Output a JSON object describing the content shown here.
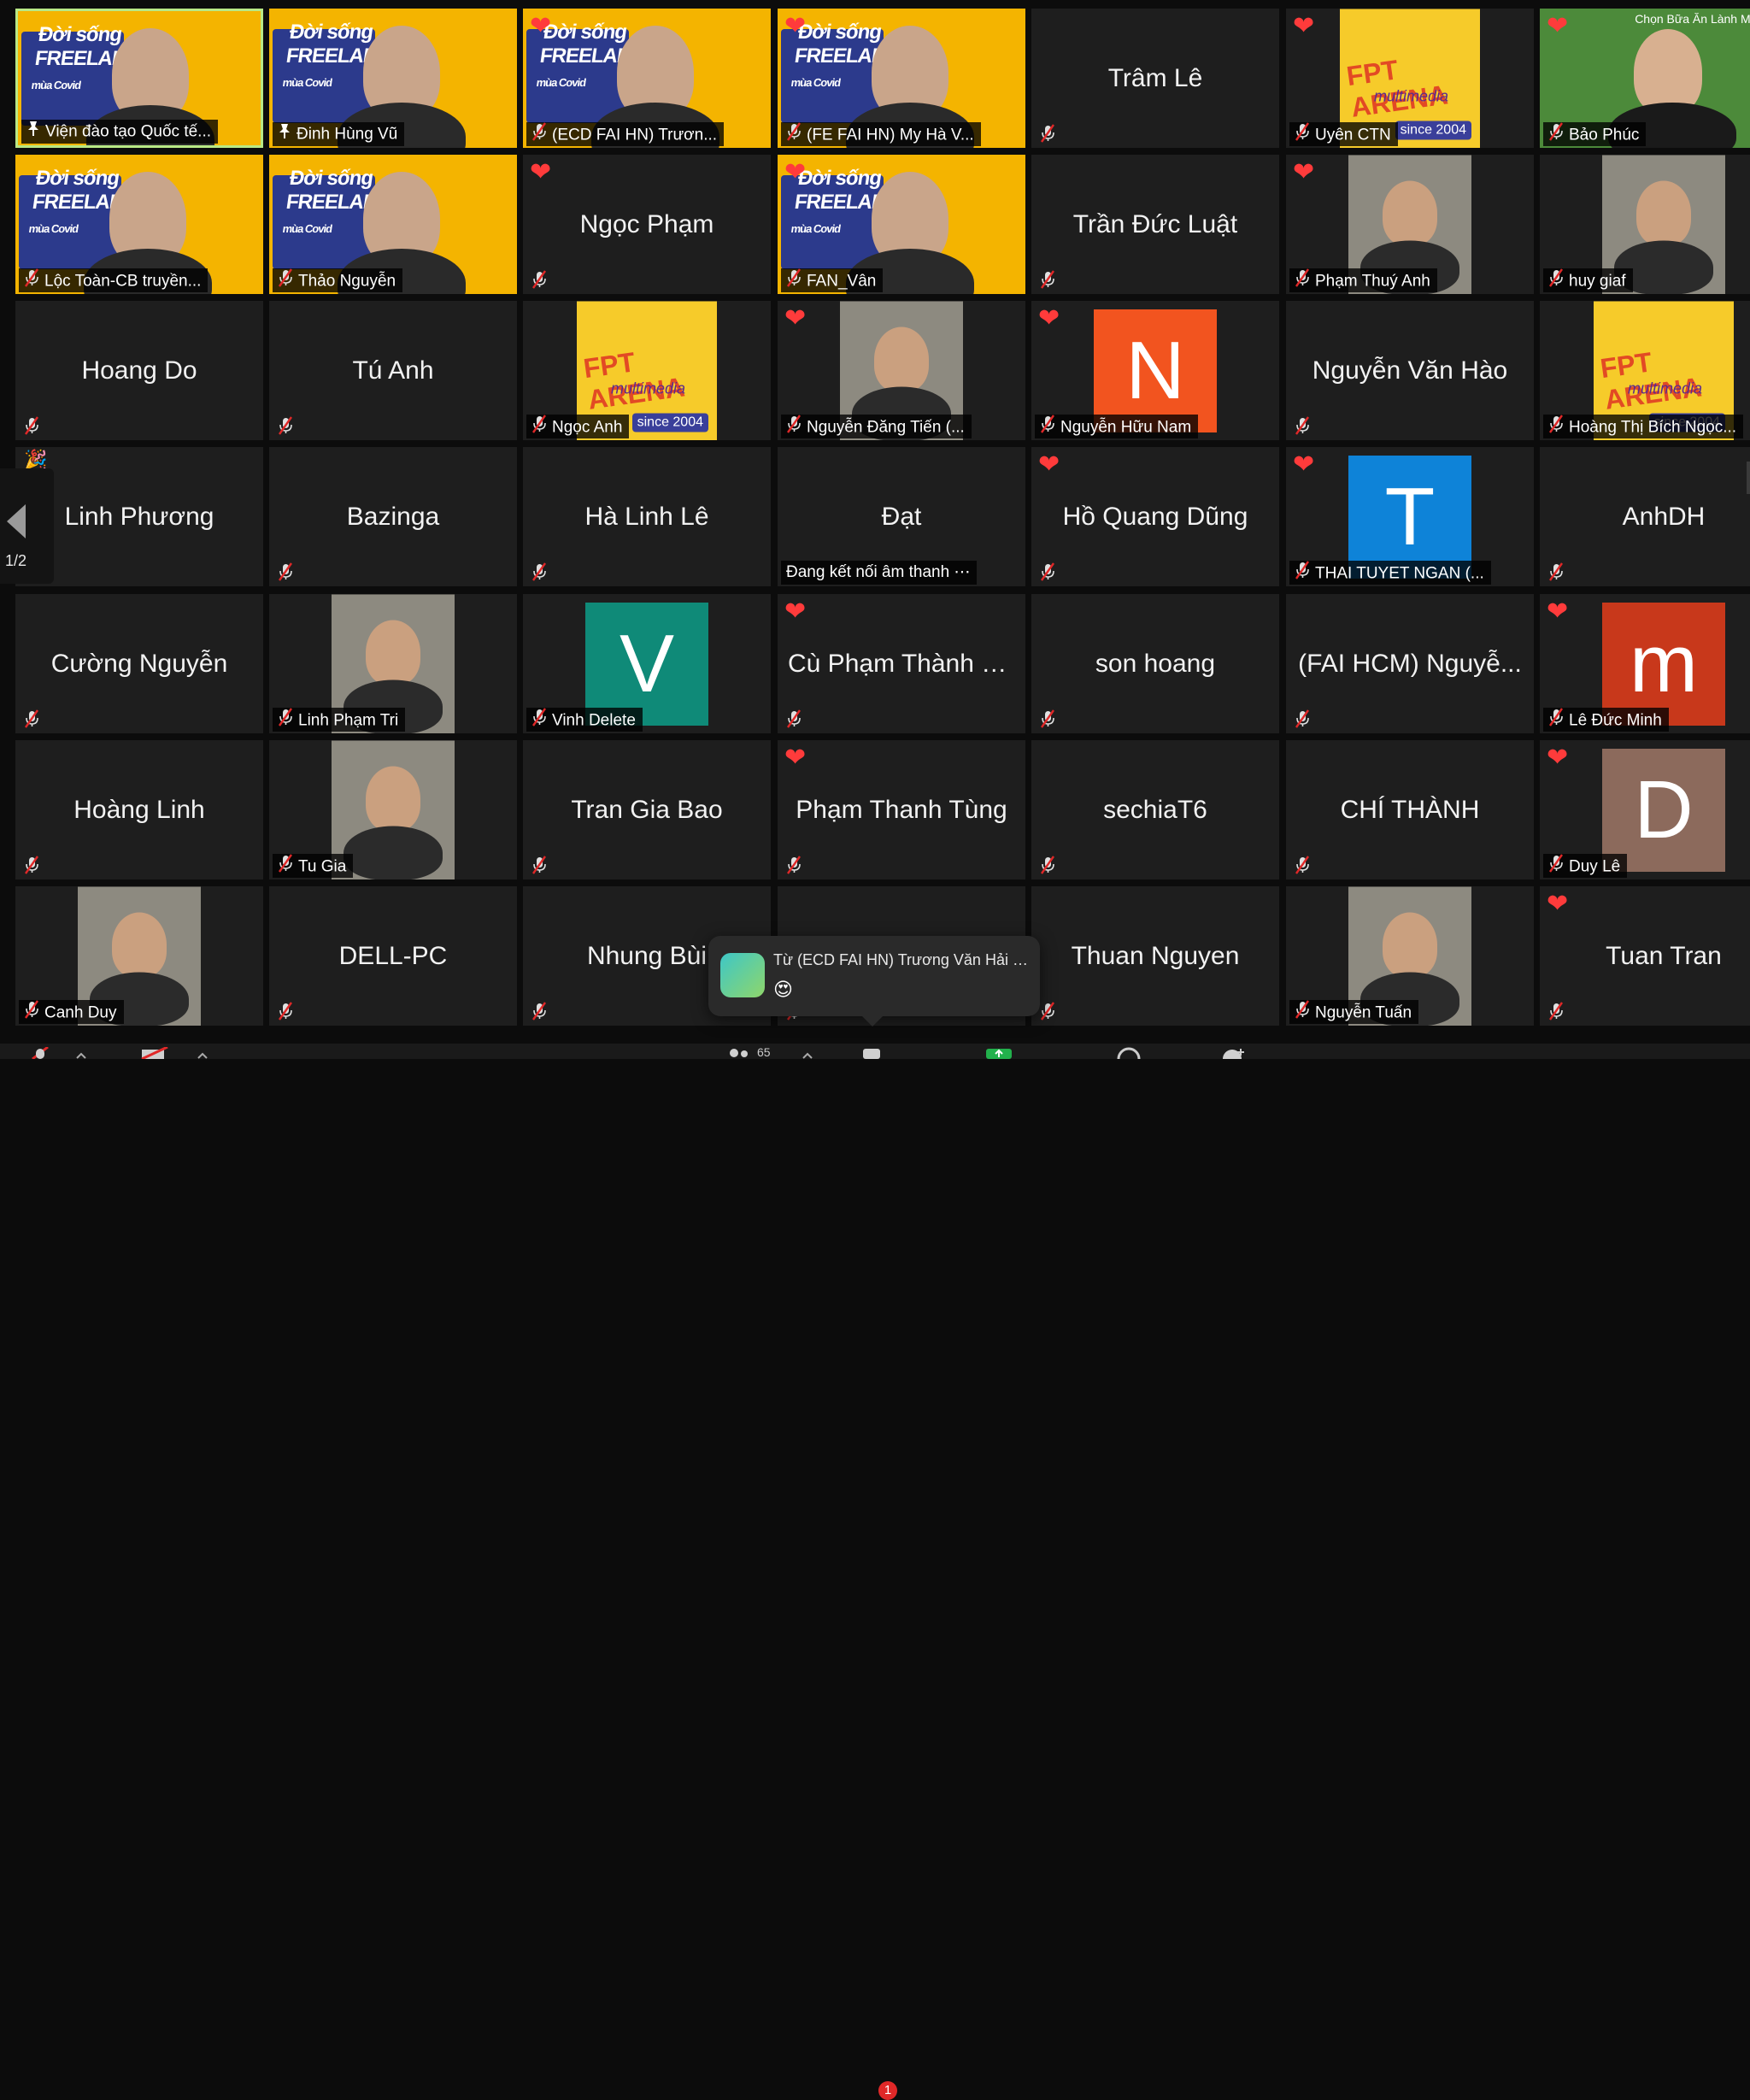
{
  "pager": {
    "page_label": "1/2"
  },
  "toast": {
    "from": "Từ (ECD FAI HN) Trương Văn Hải đ...",
    "message": "😍"
  },
  "toolbar": {
    "participants_count": "65",
    "chat_badge": "1"
  },
  "poster": {
    "brand": "FPT ARENA",
    "sub": "multimedia",
    "year": "since 2004"
  },
  "banner": {
    "line1": "Đời sống",
    "line2": "FREELANCER",
    "line3": "mùa Covid"
  },
  "rows": [
    [
      {
        "kind": "video",
        "label": "Viện đào tạo Quốc tế...",
        "pin": true,
        "active": true
      },
      {
        "kind": "video",
        "label": "Đinh Hùng Vũ",
        "pin": true
      },
      {
        "kind": "video",
        "label": "(ECD FAI HN) Trươn...",
        "heart": true
      },
      {
        "kind": "video",
        "label": "(FE FAI HN) My Hà V...",
        "heart": true,
        "muted": true
      },
      {
        "kind": "name",
        "name": "Trâm Lê",
        "muted": true
      },
      {
        "kind": "poster",
        "label": "Uyên CTN",
        "heart": true,
        "muted": true
      },
      {
        "kind": "photo",
        "label": "Bảo Phúc",
        "heart": true,
        "muted": true,
        "headline": "Chọn Bữa Ăn Lành Mạnh"
      }
    ],
    [
      {
        "kind": "video",
        "label": "Lộc Toàn-CB truyền...",
        "muted": true
      },
      {
        "kind": "video",
        "label": "Thảo Nguyễn",
        "muted": true
      },
      {
        "kind": "name",
        "name": "Ngọc Phạm",
        "heart": true,
        "muted": true
      },
      {
        "kind": "video",
        "label": "FAN_Vân",
        "heart": true,
        "muted": true
      },
      {
        "kind": "name",
        "name": "Trần Đức Luật",
        "muted": true
      },
      {
        "kind": "photo",
        "label": "Phạm Thuý Anh",
        "heart": true,
        "muted": true
      },
      {
        "kind": "photo",
        "label": "huy giaf",
        "muted": true
      }
    ],
    [
      {
        "kind": "name",
        "name": "Hoang Do",
        "muted": true
      },
      {
        "kind": "name",
        "name": "Tú Anh",
        "muted": true
      },
      {
        "kind": "poster",
        "label": "Ngọc Anh",
        "muted": true
      },
      {
        "kind": "photo",
        "label": "Nguyễn Đăng Tiến (...",
        "heart": true,
        "muted": true
      },
      {
        "kind": "letter",
        "letter": "N",
        "color": "#f2541f",
        "label": "Nguyễn Hữu Nam",
        "heart": true,
        "muted": true
      },
      {
        "kind": "name",
        "name": "Nguyễn Văn Hào",
        "muted": true
      },
      {
        "kind": "poster",
        "label": "Hoàng Thị Bích Ngọc...",
        "muted": true
      }
    ],
    [
      {
        "kind": "name",
        "name": "Linh Phương",
        "emoji": "🎉"
      },
      {
        "kind": "name",
        "name": "Bazinga",
        "muted": true
      },
      {
        "kind": "name",
        "name": "Hà Linh Lê",
        "muted": true
      },
      {
        "kind": "name",
        "name": "Đạt",
        "label": "Đang kết nối âm thanh ⋯",
        "nomic": true
      },
      {
        "kind": "name",
        "name": "Hồ Quang Dũng",
        "heart": true,
        "muted": true
      },
      {
        "kind": "letter",
        "letter": "T",
        "color": "#0e83d8",
        "label": "THAI TUYET NGAN (...",
        "heart": true,
        "muted": true
      },
      {
        "kind": "name",
        "name": "AnhDH",
        "muted": true
      }
    ],
    [
      {
        "kind": "name",
        "name": "Cường Nguyễn",
        "muted": true
      },
      {
        "kind": "photo",
        "label": "Linh Phạm Tri",
        "muted": true
      },
      {
        "kind": "letter",
        "letter": "V",
        "color": "#0f8a78",
        "label": "Vinh Delete",
        "muted": true
      },
      {
        "kind": "name",
        "name": "Cù Phạm Thành H...",
        "heart": true,
        "muted": true
      },
      {
        "kind": "name",
        "name": "son hoang",
        "muted": true
      },
      {
        "kind": "name",
        "name": "(FAI HCM) Nguyễ...",
        "muted": true
      },
      {
        "kind": "letter",
        "letter": "m",
        "color": "#c8381b",
        "label": "Lê Đức Minh",
        "heart": true,
        "muted": true
      }
    ],
    [
      {
        "kind": "name",
        "name": "Hoàng Linh",
        "muted": true
      },
      {
        "kind": "photo",
        "label": "Tu Gia",
        "muted": true
      },
      {
        "kind": "name",
        "name": "Tran Gia Bao",
        "muted": true
      },
      {
        "kind": "name",
        "name": "Phạm Thanh Tùng",
        "heart": true,
        "muted": true
      },
      {
        "kind": "name",
        "name": "sechiaT6",
        "muted": true
      },
      {
        "kind": "name",
        "name": "CHÍ THÀNH",
        "muted": true
      },
      {
        "kind": "letter",
        "letter": "D",
        "color": "#8c6a5c",
        "label": "Duy Lê",
        "heart": true,
        "muted": true
      }
    ],
    [
      {
        "kind": "photo",
        "label": "Canh Duy",
        "muted": true
      },
      {
        "kind": "name",
        "name": "DELL-PC",
        "muted": true
      },
      {
        "kind": "name",
        "name": "Nhung Bùi",
        "muted": true
      },
      {
        "kind": "name",
        "name": "",
        "muted": true
      },
      {
        "kind": "name",
        "name": "Thuan Nguyen",
        "muted": true
      },
      {
        "kind": "photo",
        "label": "Nguyễn Tuấn",
        "muted": true
      },
      {
        "kind": "name",
        "name": "Tuan Tran",
        "heart": true,
        "muted": true
      }
    ]
  ]
}
